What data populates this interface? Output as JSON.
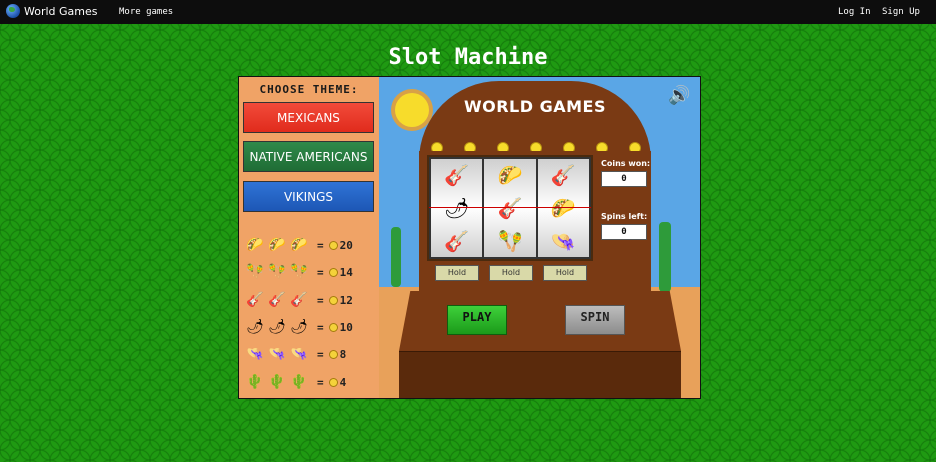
{
  "topbar": {
    "brand": "World Games",
    "more_games": "More games",
    "login": "Log In",
    "signup": "Sign Up"
  },
  "page_title": "Slot Machine",
  "theme_panel": {
    "title": "CHOOSE THEME:",
    "themes": [
      "MEXICANS",
      "NATIVE AMERICANS",
      "VIKINGS"
    ]
  },
  "paytable": [
    {
      "symbol": "taco-icon",
      "glyph": "🌮",
      "value": "20"
    },
    {
      "symbol": "maracas-icon",
      "glyph": "🪇",
      "value": "14"
    },
    {
      "symbol": "guitar-icon",
      "glyph": "🎸",
      "value": "12"
    },
    {
      "symbol": "chili-icon",
      "glyph": "🌶",
      "value": "10"
    },
    {
      "symbol": "sombrero-icon",
      "glyph": "👒",
      "value": "8"
    },
    {
      "symbol": "cactus-icon",
      "glyph": "🌵",
      "value": "4"
    }
  ],
  "machine": {
    "title": "WORLD GAMES",
    "coins_won_label": "Coins won:",
    "coins_won_value": "0",
    "spins_left_label": "Spins left:",
    "spins_left_value": "0",
    "hold_label": "Hold",
    "play_label": "PLAY",
    "spin_label": "SPIN",
    "reels": [
      [
        "🎸",
        "🌶",
        "🎸"
      ],
      [
        "🌮",
        "🎸",
        "🪇"
      ],
      [
        "🎸",
        "🌮",
        "👒"
      ]
    ]
  },
  "colors": {
    "background": "#1f9a12",
    "mexicans": "#e02b1c",
    "native_americans": "#1f6d35",
    "vikings": "#1d57b5",
    "play": "#1b9a1a",
    "spin": "#8c8c8c"
  }
}
